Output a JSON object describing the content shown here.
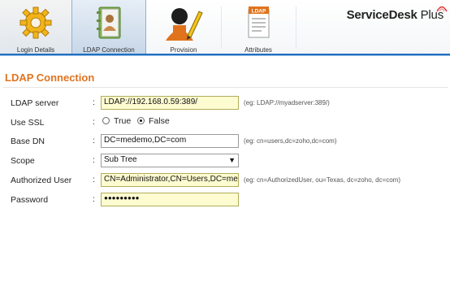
{
  "tabs": [
    {
      "label": "Login Details",
      "icon": "gear-icon"
    },
    {
      "label": "LDAP Connection",
      "icon": "address-book-icon"
    },
    {
      "label": "Provision",
      "icon": "user-pencil-icon"
    },
    {
      "label": "Attributes",
      "icon": "ldap-document-icon"
    }
  ],
  "active_tab": "LDAP Connection",
  "brand": {
    "name": "ServiceDesk",
    "suffix": " Plus"
  },
  "section_title": "LDAP Connection",
  "form": {
    "ldap_server": {
      "label": "LDAP server",
      "value": "LDAP://192.168.0.59:389/",
      "hint": "(eg: LDAP://myadserver:389/)"
    },
    "use_ssl": {
      "label": "Use SSL",
      "options": [
        "True",
        "False"
      ],
      "selected": "False"
    },
    "base_dn": {
      "label": "Base DN",
      "value": "DC=medemo,DC=com",
      "hint": "(eg: cn=users,dc=zoho,dc=com)"
    },
    "scope": {
      "label": "Scope",
      "value": "Sub Tree"
    },
    "authorized_user": {
      "label": "Authorized User",
      "value": "CN=Administrator,CN=Users,DC=medemo,DC=com",
      "hint": "(eg: cn=AuthorizedUser, ou=Texas, dc=zoho, dc=com)"
    },
    "password": {
      "label": "Password",
      "value": "●●●●●●●●●"
    }
  },
  "colon": ":",
  "colors": {
    "accent": "#e2731f",
    "nav_blue": "#1f6fbf",
    "field_yellow": "#fdfbd0"
  }
}
